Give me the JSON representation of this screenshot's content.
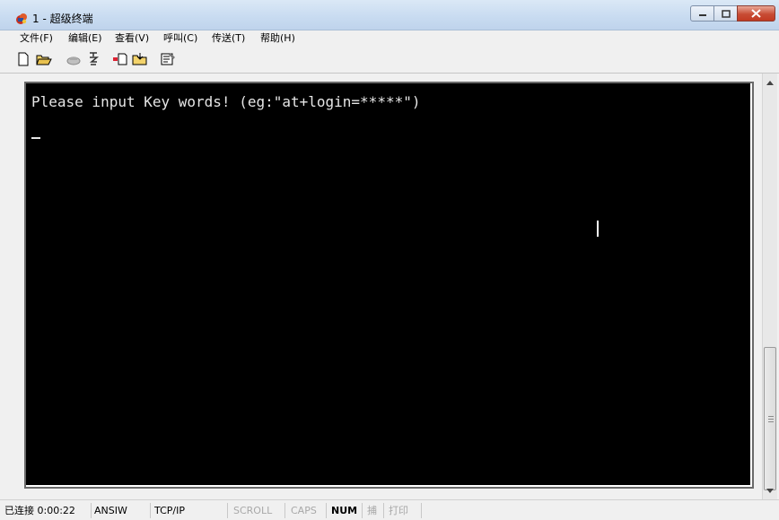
{
  "window": {
    "title": "1 - 超级终端",
    "icons": {
      "app": "hyperterminal-phone-icon",
      "minimize": "minimize-icon",
      "maximize": "maximize-icon",
      "close": "close-icon"
    }
  },
  "menu": [
    "文件(F)",
    "编辑(E)",
    "查看(V)",
    "呼叫(C)",
    "传送(T)",
    "帮助(H)"
  ],
  "toolbar": [
    "new-document-icon",
    "open-folder-icon",
    "call-icon",
    "disconnect-icon",
    "send-file-icon",
    "receive-file-icon",
    "properties-icon"
  ],
  "terminal": {
    "line1": "Please input Key words! (eg:\"at+login=*****\")",
    "background": "#000000",
    "foreground": "#e6e6e6"
  },
  "statusbar": {
    "connected": "已连接 0:00:22",
    "emulation": "ANSIW",
    "protocol": "TCP/IP",
    "scroll": "SCROLL",
    "caps": "CAPS",
    "num": "NUM",
    "capture": "捕",
    "print": "打印"
  }
}
